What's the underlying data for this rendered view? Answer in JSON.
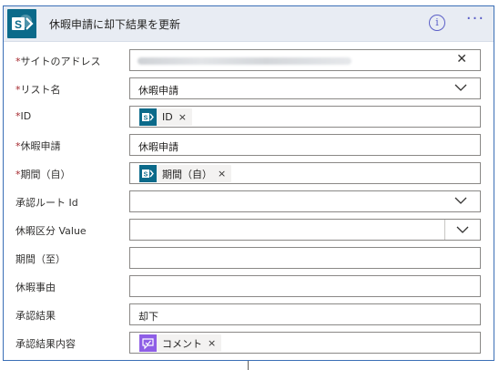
{
  "header": {
    "title": "休暇申請に却下結果を更新",
    "info_label": "i",
    "more_label": "···"
  },
  "fields": [
    {
      "required": true,
      "label": "サイトのアドレス",
      "value": ""
    },
    {
      "required": true,
      "label": "リスト名",
      "value": "休暇申請"
    },
    {
      "required": true,
      "label": "ID",
      "token": "ID"
    },
    {
      "required": true,
      "label": "休暇申請",
      "value": "休暇申請"
    },
    {
      "required": true,
      "label": "期間（自）",
      "token": "期間（自）"
    },
    {
      "required": false,
      "label": "承認ルート Id",
      "value": ""
    },
    {
      "required": false,
      "label": "休暇区分 Value",
      "value": ""
    },
    {
      "required": false,
      "label": "期間（至）",
      "value": ""
    },
    {
      "required": false,
      "label": "休暇事由",
      "value": ""
    },
    {
      "required": false,
      "label": "承認結果",
      "value": "却下"
    },
    {
      "required": false,
      "label": "承認結果内容",
      "token": "コメント"
    }
  ],
  "required_marker": "*",
  "token_remove": "×",
  "colors": {
    "sharepoint": "#0b6a8a",
    "approval": "#8e5ee6",
    "accent": "#5b5fc7",
    "border": "#3b6fb6",
    "required": "#a4262c"
  },
  "icons": {
    "app": "sharepoint-icon",
    "token_sharepoint": "sharepoint-icon",
    "token_approval": "approval-icon",
    "clear": "close-icon",
    "dropdown": "chevron-down-icon"
  }
}
